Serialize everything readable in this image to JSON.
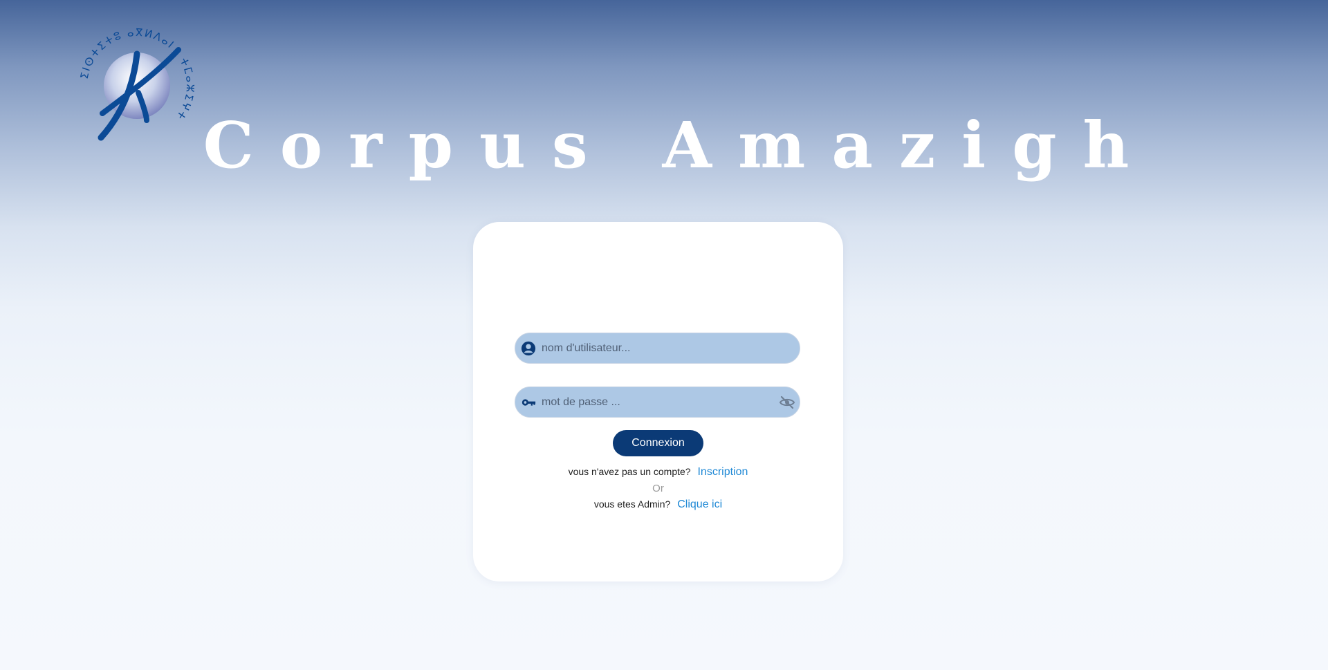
{
  "brand": {
    "title": "Corpus Amazigh",
    "logo_icon": "ircam-logo-icon",
    "logo_glyph_ring": "ⵉⵏⵙⵜⵉⵜⵓ ⴰⴳⵍⴷⴰⵏ ⵏ ⵜⵎⴰⵣⵉⵖⵜ"
  },
  "login": {
    "username_placeholder": "nom d'utilisateur...",
    "username_icon": "user-circle-icon",
    "password_placeholder": "mot de passe ...",
    "password_icon": "key-icon",
    "toggle_visibility_icon": "eye-off-icon",
    "submit_label": "Connexion"
  },
  "signup": {
    "prompt": "vous n'avez pas un compte?",
    "link_label": "Inscription"
  },
  "separator": "Or",
  "admin": {
    "prompt": "vous etes Admin?",
    "link_label": "Clique ici"
  },
  "colors": {
    "primary": "#0b3a76",
    "link": "#1e88d5",
    "field_bg": "#adc8e5",
    "header_top": "#46659a",
    "page_bottom": "#f5f8fd"
  }
}
